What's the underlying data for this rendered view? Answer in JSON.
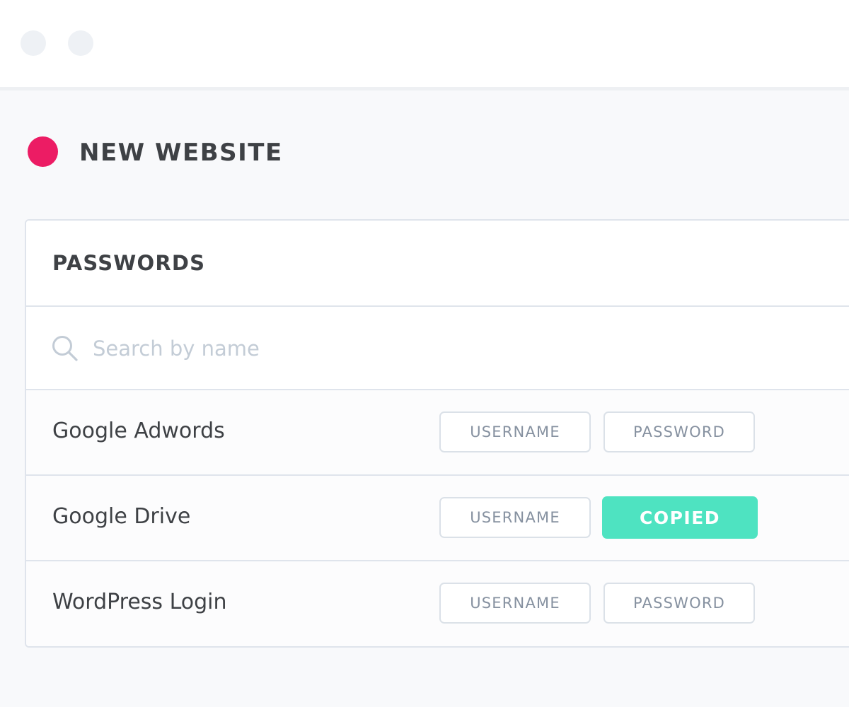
{
  "colors": {
    "project_dot": "#ec1c64",
    "copied_bg": "#4ee3c1"
  },
  "window": {
    "controls": [
      "window-dot",
      "window-dot"
    ]
  },
  "project": {
    "title": "NEW WEBSITE"
  },
  "panel": {
    "title": "PASSWORDS",
    "search": {
      "icon": "search-icon",
      "placeholder": "Search by name",
      "value": ""
    },
    "rows": [
      {
        "name": "Google Adwords",
        "username_label": "USERNAME",
        "password_label": "PASSWORD"
      },
      {
        "name": "Google Drive",
        "username_label": "USERNAME",
        "password_label": "COPIED"
      },
      {
        "name": "WordPress Login",
        "username_label": "USERNAME",
        "password_label": "PASSWORD"
      }
    ]
  }
}
